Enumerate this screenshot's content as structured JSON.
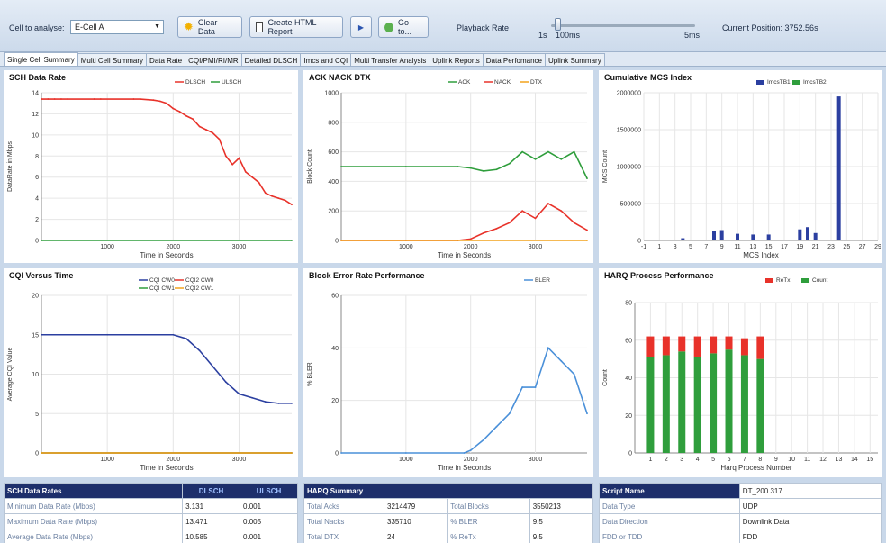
{
  "toolbar": {
    "cell_label": "Cell to analyse:",
    "cell_value": "E-Cell A",
    "clear_label": "Clear Data",
    "report_label": "Create HTML Report",
    "play_label": "▶",
    "goto_label": "Go to...",
    "playback_label": "Playback Rate",
    "min_label": "1s",
    "cur_rate": "100ms",
    "max_label": "5ms",
    "position_label": "Current Position: 3752.56s"
  },
  "tabs": [
    "Single Cell Summary",
    "Multi Cell Summary",
    "Data Rate",
    "CQI/PMI/RI/MR",
    "Detailed DLSCH",
    "Imcs and CQI",
    "Multi Transfer Analysis",
    "Uplink Reports",
    "Data Perfomance",
    "Uplink Summary"
  ],
  "colors": {
    "red": "#e8322a",
    "green": "#2f9e3c",
    "orange": "#f2a21c",
    "blue": "#2b3fa0",
    "lightblue": "#4a90d9"
  },
  "charts": {
    "sch": {
      "title": "SCH Data Rate",
      "legend": [
        "DLSCH",
        "ULSCH"
      ],
      "xlabel": "Time in Seconds",
      "ylabel": "DataRate in Mbps",
      "yticks": [
        "0",
        "2",
        "4",
        "6",
        "8",
        "10",
        "12",
        "14"
      ],
      "xticks": [
        "1000",
        "2000",
        "3000"
      ]
    },
    "ack": {
      "title": "ACK NACK DTX",
      "legend": [
        "ACK",
        "NACK",
        "DTX"
      ],
      "xlabel": "Time in Seconds",
      "ylabel": "Block Count",
      "yticks": [
        "0",
        "200",
        "400",
        "600",
        "800",
        "1000"
      ],
      "xticks": [
        "1000",
        "2000",
        "3000"
      ]
    },
    "mcs": {
      "title": "Cumulative MCS Index",
      "legend": [
        "ImcsTB1",
        "ImcsTB2"
      ],
      "xlabel": "MCS Index",
      "ylabel": "MCS Count",
      "yticks": [
        "0",
        "500000",
        "1000000",
        "1500000",
        "2000000"
      ],
      "xticks": [
        "-1",
        "1",
        "3",
        "5",
        "7",
        "9",
        "11",
        "13",
        "15",
        "17",
        "19",
        "21",
        "23",
        "25",
        "27",
        "29"
      ]
    },
    "cqi": {
      "title": "CQI Versus Time",
      "legend": [
        "CQI CW0",
        "CQI2 CW0",
        "CQI CW1",
        "CQI2 CW1"
      ],
      "xlabel": "Time in Seconds",
      "ylabel": "Average CQI Value",
      "yticks": [
        "0",
        "5",
        "10",
        "15",
        "20"
      ],
      "xticks": [
        "1000",
        "2000",
        "3000"
      ]
    },
    "bler": {
      "title": "Block Error Rate Performance",
      "legend": [
        "BLER"
      ],
      "xlabel": "Time in Seconds",
      "ylabel": "% BLER",
      "yticks": [
        "0",
        "20",
        "40",
        "60"
      ],
      "xticks": [
        "1000",
        "2000",
        "3000"
      ]
    },
    "harq": {
      "title": "HARQ Process Performance",
      "legend": [
        "ReTx",
        "Count"
      ],
      "xlabel": "Harq Process Number",
      "ylabel": "Count",
      "yticks": [
        "0",
        "20",
        "40",
        "60",
        "80"
      ],
      "xticks": [
        "1",
        "2",
        "3",
        "4",
        "5",
        "6",
        "7",
        "8",
        "9",
        "10",
        "11",
        "12",
        "13",
        "14",
        "15"
      ]
    }
  },
  "chart_data": [
    {
      "type": "line",
      "title": "SCH Data Rate",
      "xlabel": "Time in Seconds",
      "ylabel": "DataRate in Mbps",
      "ylim": [
        0,
        14
      ],
      "xlim": [
        0,
        3800
      ],
      "series": [
        {
          "name": "DLSCH",
          "x": [
            0,
            100,
            200,
            300,
            400,
            800,
            900,
            1400,
            1500,
            1700,
            1800,
            1900,
            2000,
            2100,
            2200,
            2300,
            2400,
            2500,
            2600,
            2700,
            2800,
            2900,
            3000,
            3100,
            3200,
            3300,
            3400,
            3500,
            3600,
            3700,
            3800
          ],
          "values": [
            13.4,
            13.4,
            13.4,
            13.4,
            13.4,
            13.4,
            13.4,
            13.4,
            13.4,
            13.3,
            13.2,
            13,
            12.5,
            12.2,
            11.8,
            11.5,
            10.8,
            10.5,
            10.2,
            9.6,
            8,
            7.2,
            7.8,
            6.5,
            6,
            5.5,
            4.5,
            4.2,
            4,
            3.8,
            3.4
          ]
        },
        {
          "name": "ULSCH",
          "x": [
            0,
            3800
          ],
          "values": [
            0,
            0
          ]
        }
      ]
    },
    {
      "type": "line",
      "title": "ACK NACK DTX",
      "xlabel": "Time in Seconds",
      "ylabel": "Block Count",
      "ylim": [
        0,
        1000
      ],
      "xlim": [
        0,
        3800
      ],
      "series": [
        {
          "name": "ACK",
          "x": [
            0,
            1000,
            1800,
            2000,
            2200,
            2400,
            2600,
            2800,
            3000,
            3200,
            3400,
            3600,
            3800
          ],
          "values": [
            500,
            500,
            500,
            490,
            470,
            480,
            520,
            600,
            550,
            600,
            550,
            600,
            420
          ]
        },
        {
          "name": "NACK",
          "x": [
            0,
            1000,
            1800,
            2000,
            2200,
            2400,
            2600,
            2800,
            3000,
            3200,
            3400,
            3600,
            3800
          ],
          "values": [
            0,
            0,
            0,
            10,
            50,
            80,
            120,
            200,
            150,
            250,
            200,
            120,
            70
          ]
        },
        {
          "name": "DTX",
          "x": [
            0,
            3800
          ],
          "values": [
            0,
            0
          ]
        }
      ]
    },
    {
      "type": "bar",
      "title": "Cumulative MCS Index",
      "xlabel": "MCS Index",
      "ylabel": "MCS Count",
      "ylim": [
        0,
        2000000
      ],
      "categories": [
        "4",
        "8",
        "9",
        "11",
        "13",
        "15",
        "19",
        "20",
        "21",
        "24"
      ],
      "series": [
        {
          "name": "ImcsTB1",
          "values": [
            30000,
            130000,
            140000,
            90000,
            80000,
            80000,
            150000,
            180000,
            100000,
            1950000
          ]
        },
        {
          "name": "ImcsTB2",
          "values": [
            0,
            0,
            0,
            0,
            0,
            0,
            0,
            0,
            0,
            0
          ]
        }
      ]
    },
    {
      "type": "line",
      "title": "CQI Versus Time",
      "xlabel": "Time in Seconds",
      "ylabel": "Average CQI Value",
      "ylim": [
        0,
        20
      ],
      "xlim": [
        0,
        3800
      ],
      "series": [
        {
          "name": "CQI CW0",
          "x": [
            0,
            1000,
            2000,
            2200,
            2400,
            2600,
            2800,
            3000,
            3200,
            3400,
            3600,
            3800
          ],
          "values": [
            15,
            15,
            15,
            14.5,
            13,
            11,
            9,
            7.5,
            7,
            6.5,
            6.3,
            6.3
          ]
        },
        {
          "name": "CQI2 CW0",
          "x": [
            0,
            3800
          ],
          "values": [
            0,
            0
          ]
        },
        {
          "name": "CQI CW1",
          "x": [
            0,
            3800
          ],
          "values": [
            0,
            0
          ]
        },
        {
          "name": "CQI2 CW1",
          "x": [
            0,
            3800
          ],
          "values": [
            0,
            0
          ]
        }
      ]
    },
    {
      "type": "line",
      "title": "Block Error Rate Performance",
      "xlabel": "Time in Seconds",
      "ylabel": "% BLER",
      "ylim": [
        0,
        60
      ],
      "xlim": [
        0,
        3800
      ],
      "series": [
        {
          "name": "BLER",
          "x": [
            0,
            1000,
            1900,
            2000,
            2200,
            2400,
            2600,
            2800,
            3000,
            3200,
            3400,
            3600,
            3800
          ],
          "values": [
            0,
            0,
            0,
            1,
            5,
            10,
            15,
            25,
            25,
            40,
            35,
            30,
            15
          ]
        }
      ]
    },
    {
      "type": "bar",
      "title": "HARQ Process Performance",
      "xlabel": "Harq Process Number",
      "ylabel": "Count",
      "ylim": [
        0,
        80
      ],
      "categories": [
        "1",
        "2",
        "3",
        "4",
        "5",
        "6",
        "7",
        "8"
      ],
      "series": [
        {
          "name": "Count",
          "values": [
            51,
            52,
            54,
            51,
            53,
            55,
            52,
            50
          ]
        },
        {
          "name": "ReTx",
          "values": [
            11,
            10,
            8,
            11,
            9,
            7,
            9,
            12
          ]
        }
      ]
    }
  ],
  "tables": {
    "sch": {
      "header": [
        "SCH Data Rates",
        "DLSCH",
        "ULSCH"
      ],
      "rows": [
        [
          "Minimum Data Rate (Mbps)",
          "3.131",
          "0.001"
        ],
        [
          "Maximum Data Rate (Mbps)",
          "13.471",
          "0.005"
        ],
        [
          "Average Data Rate (Mbps)",
          "10.585",
          "0.001"
        ]
      ]
    },
    "harq": {
      "header": [
        "HARQ Summary"
      ],
      "rows": [
        [
          "Total Acks",
          "3214479",
          "Total Blocks",
          "3550213"
        ],
        [
          "Total Nacks",
          "335710",
          "% BLER",
          "9.5"
        ],
        [
          "Total DTX",
          "24",
          "% ReTx",
          "9.5"
        ]
      ]
    },
    "script": {
      "header": [
        "Script Name",
        "DT_200.317"
      ],
      "rows": [
        [
          "Data Type",
          "UDP"
        ],
        [
          "Data Direction",
          "Downlink Data"
        ],
        [
          "FDD or TDD",
          "FDD"
        ]
      ]
    }
  }
}
